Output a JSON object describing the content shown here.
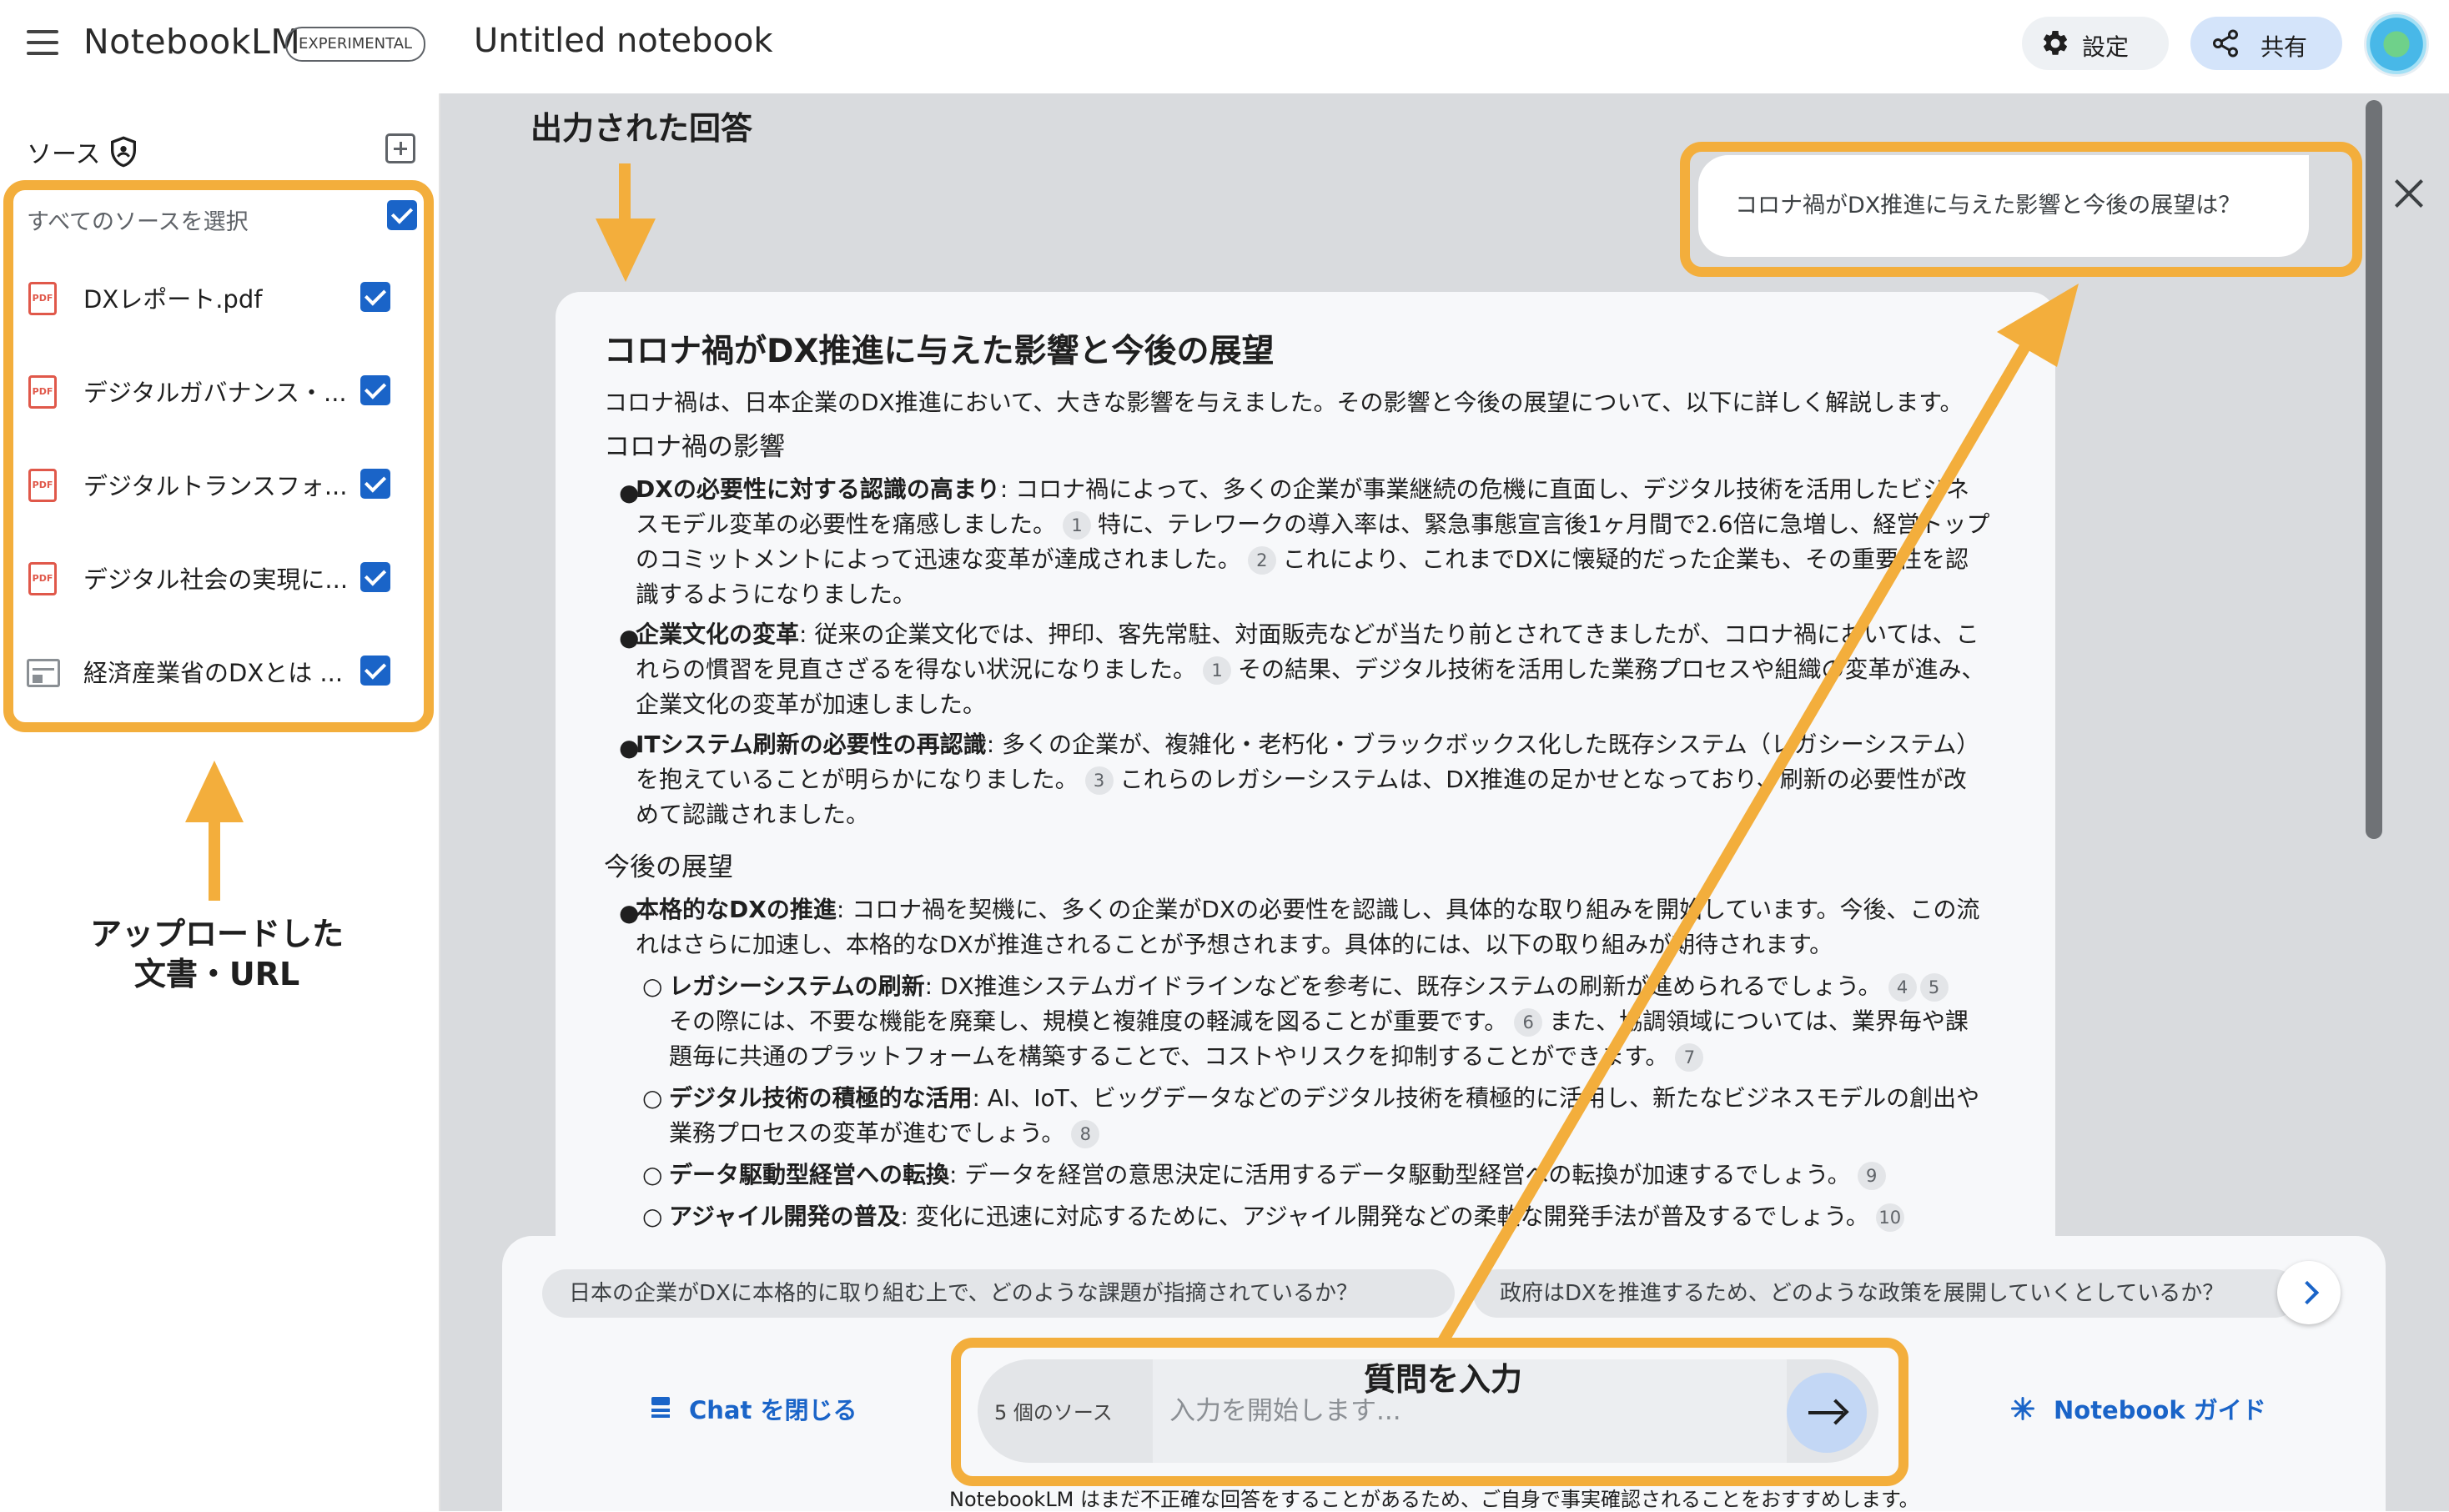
{
  "app": {
    "name": "NotebookLM",
    "badge": "EXPERIMENTAL",
    "notebook_title": "Untitled notebook"
  },
  "header": {
    "settings_label": "設定",
    "share_label": "共有"
  },
  "sidebar": {
    "title": "ソース",
    "select_all_label": "すべてのソースを選択",
    "items": [
      {
        "label": "DXレポート.pdf",
        "type": "pdf",
        "checked": true
      },
      {
        "label": "デジタルガバナンス・...",
        "type": "pdf",
        "checked": true
      },
      {
        "label": "デジタルトランスフォ...",
        "type": "pdf",
        "checked": true
      },
      {
        "label": "デジタル社会の実現に...",
        "type": "pdf",
        "checked": true
      },
      {
        "label": "経済産業省のDXとは ...",
        "type": "web",
        "checked": true
      }
    ]
  },
  "chat": {
    "question": "コロナ禍がDX推進に与えた影響と今後の展望は？",
    "answer_title": "コロナ禍がDX推進に与えた影響と今後の展望",
    "answer_intro": "コロナ禍は、日本企業のDX推進において、大きな影響を与えました。その影響と今後の展望について、以下に詳しく解説します。",
    "section1_heading": "コロナ禍の影響",
    "b1_lead": "DXの必要性に対する認識の高まり",
    "b1_l1": ": コロナ禍によって、多くの企業が事業継続の危機に直面し、デジタル技術を活用したビジネ",
    "b1_l2a": "スモデル変革の必要性を痛感しました。",
    "b1_l2b": "特に、テレワークの導入率は、緊急事態宣言後1ヶ月間で2.6倍に急増し、経営トップ",
    "b1_l3a": "のコミットメントによって迅速な変革が達成されました。",
    "b1_l3b": "これにより、これまでDXに懐疑的だった企業も、その重要性を認",
    "b1_l4": "識するようになりました。",
    "b2_lead": "企業文化の変革",
    "b2_l1": ": 従来の企業文化では、押印、客先常駐、対面販売などが当たり前とされてきましたが、コロナ禍においては、こ",
    "b2_l2a": "れらの慣習を見直さざるを得ない状況になりました。",
    "b2_l2b": "その結果、デジタル技術を活用した業務プロセスや組織の変革が進み、",
    "b2_l3": "企業文化の変革が加速しました。",
    "b3_lead": "ITシステム刷新の必要性の再認識",
    "b3_l1": ": 多くの企業が、複雑化・老朽化・ブラックボックス化した既存システム（レガシーシステム）",
    "b3_l2a": "を抱えていることが明らかになりました。",
    "b3_l2b": "これらのレガシーシステムは、DX推進の足かせとなっており、刷新の必要性が改",
    "b3_l3": "めて認識されました。",
    "section2_heading": "今後の展望",
    "b4_lead": "本格的なDXの推進",
    "b4_l1": ": コロナ禍を契機に、多くの企業がDXの必要性を認識し、具体的な取り組みを開始しています。今後、この流",
    "b4_l2": "れはさらに加速し、本格的なDXが推進されることが予想されます。具体的には、以下の取り組みが期待されます。",
    "s1_lead": "レガシーシステムの刷新",
    "s1_l1": ": DX推進システムガイドラインなどを参考に、既存システムの刷新が進められるでしょう。",
    "s1_l2a": "その際には、不要な機能を廃棄し、規模と複雑度の軽減を図ることが重要です。",
    "s1_l2b": "また、協調領域については、業界毎や課",
    "s1_l3": "題毎に共通のプラットフォームを構築することで、コストやリスクを抑制することができます。",
    "s2_lead": "デジタル技術の積極的な活用",
    "s2_l1": ": AI、IoT、ビッグデータなどのデジタル技術を積極的に活用し、新たなビジネスモデルの創出や",
    "s2_l2": "業務プロセスの変革が進むでしょう。",
    "s3_lead": "データ駆動型経営への転換",
    "s3_l1": ": データを経営の意思決定に活用するデータ駆動型経営への転換が加速するでしょう。",
    "s4_lead": "アジャイル開発の普及",
    "s4_l1": ": 変化に迅速に対応するために、アジャイル開発などの柔軟な開発手法が普及するでしょう。",
    "citations": {
      "c1": "1",
      "c2": "2",
      "c3": "1",
      "c4": "3",
      "c5": "4",
      "c6": "5",
      "c7": "6",
      "c8": "7",
      "c9": "8",
      "c10": "9",
      "c11": "10"
    },
    "suggestions": [
      "日本の企業がDXに本格的に取り組む上で、どのような課題が指摘されているか？",
      "政府はDXを推進するため、どのような政策を展開していくとしているか？"
    ],
    "close_chat_label": "Chat を閉じる",
    "source_count": "5 個のソース",
    "input_placeholder": "入力を開始します...",
    "guide_label": "Notebook ガイド",
    "disclaimer": "NotebookLM はまだ不正確な回答をすることがあるため、ご自身で事実確認されることをおすすめします。"
  },
  "annotations": {
    "answer_label": "出力された回答",
    "upload_label_line1": "アップロードした",
    "upload_label_line2": "文書・URL",
    "input_label": "質問を入力"
  },
  "colors": {
    "accent": "#1a64c8",
    "highlight": "#f3ae3c",
    "pdf_icon": "#e0584a",
    "main_bg": "#d9dbde"
  },
  "icons": {
    "menu": "hamburger-icon",
    "settings": "gear-icon",
    "share": "share-icon",
    "source_shield": "shield-icon",
    "add_source": "add-box-icon",
    "close": "close-icon",
    "next": "chevron-right-icon",
    "send": "arrow-right-icon",
    "close_chat": "chat-icon",
    "guide": "sparkle-icon"
  }
}
